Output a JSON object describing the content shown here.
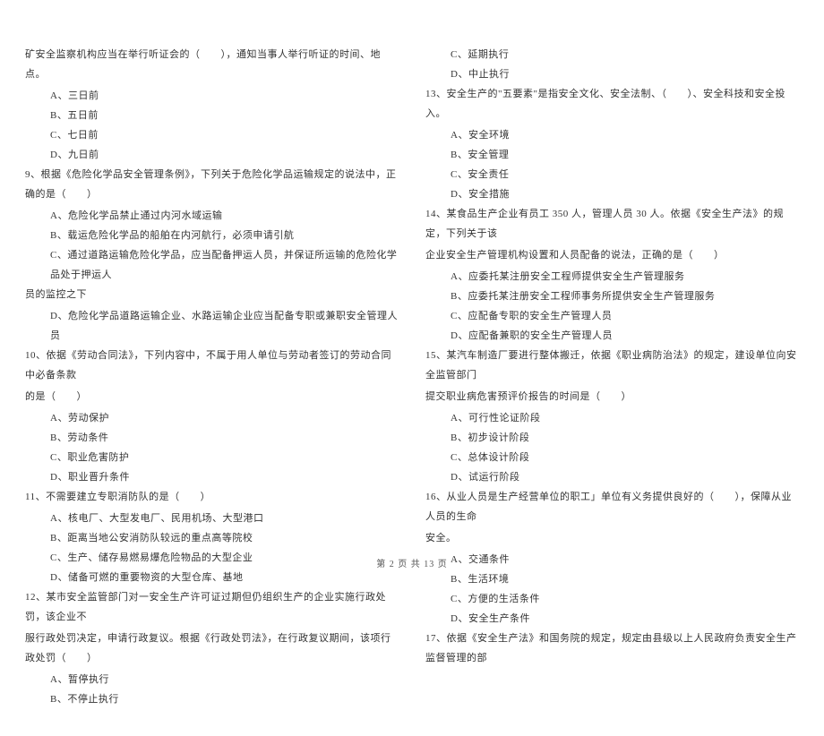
{
  "left": {
    "q8_tail": "矿安全监察机构应当在举行听证会的（　　），通知当事人举行听证的时间、地点。",
    "q8_opts": [
      "A、三日前",
      "B、五日前",
      "C、七日前",
      "D、九日前"
    ],
    "q9_stem": "9、根据《危险化学品安全管理条例》，下列关于危险化学品运输规定的说法中，正确的是（　　）",
    "q9_opts": [
      "A、危险化学品禁止通过内河水域运输",
      "B、载运危险化学品的船舶在内河航行，必须申请引航",
      "C、通过道路运输危险化学品，应当配备押运人员，并保证所运输的危险化学品处于押运人"
    ],
    "q9_c_tail": "员的监控之下",
    "q9_d": "D、危险化学品道路运输企业、水路运输企业应当配备专职或兼职安全管理人员",
    "q10_stem": "10、依据《劳动合同法》，下列内容中，不属于用人单位与劳动者签订的劳动合同中必备条款",
    "q10_stem_tail": "的是（　　）",
    "q10_opts": [
      "A、劳动保护",
      "B、劳动条件",
      "C、职业危害防护",
      "D、职业晋升条件"
    ],
    "q11_stem": "11、不需要建立专职消防队的是（　　）",
    "q11_opts": [
      "A、核电厂、大型发电厂、民用机场、大型港口",
      "B、距离当地公安消防队较远的重点高等院校",
      "C、生产、储存易燃易爆危险物品的大型企业",
      "D、储备可燃的重要物资的大型仓库、基地"
    ],
    "q12_stem": "12、某市安全监管部门对一安全生产许可证过期但仍组织生产的企业实施行政处罚，该企业不",
    "q12_stem2": "服行政处罚决定，申请行政复议。根据《行政处罚法》，在行政复议期间，该项行政处罚（　　）",
    "q12_opts": [
      "A、暂停执行",
      "B、不停止执行"
    ]
  },
  "right": {
    "q12_opts_cont": [
      "C、延期执行",
      "D、中止执行"
    ],
    "q13_stem": "13、安全生产的\"五要素\"是指安全文化、安全法制、（　　）、安全科技和安全投入。",
    "q13_opts": [
      "A、安全环境",
      "B、安全管理",
      "C、安全责任",
      "D、安全措施"
    ],
    "q14_stem": "14、某食品生产企业有员工 350 人，管理人员 30 人。依据《安全生产法》的规定，下列关于该",
    "q14_stem2": "企业安全生产管理机构设置和人员配备的说法，正确的是（　　）",
    "q14_opts": [
      "A、应委托某注册安全工程师提供安全生产管理服务",
      "B、应委托某注册安全工程师事务所提供安全生产管理服务",
      "C、应配备专职的安全生产管理人员",
      "D、应配备兼职的安全生产管理人员"
    ],
    "q15_stem": "15、某汽车制造厂要进行整体搬迁，依据《职业病防治法》的规定，建设单位向安全监管部门",
    "q15_stem2": "提交职业病危害预评价报告的时间是（　　）",
    "q15_opts": [
      "A、可行性论证阶段",
      "B、初步设计阶段",
      "C、总体设计阶段",
      "D、试运行阶段"
    ],
    "q16_stem": "16、从业人员是生产经营单位的职工」单位有义务提供良好的（　　），保障从业人员的生命",
    "q16_stem2": "安全。",
    "q16_opts": [
      "A、交通条件",
      "B、生活环境",
      "C、方便的生活条件",
      "D、安全生产条件"
    ],
    "q17_stem": "17、依据《安全生产法》和国务院的规定，规定由县级以上人民政府负责安全生产监督管理的部"
  },
  "footer": "第 2 页 共 13 页"
}
